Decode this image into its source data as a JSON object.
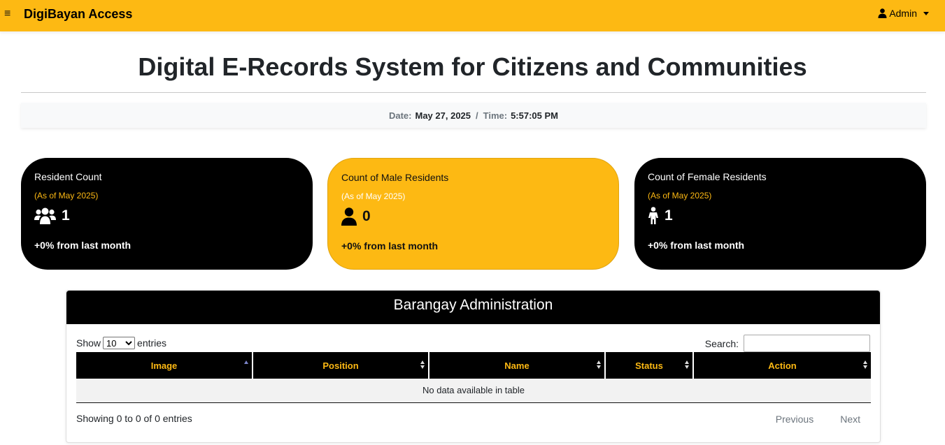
{
  "navbar": {
    "menu_icon": "hamburger-icon",
    "brand": "DigiBayan Access",
    "user_icon": "user-icon",
    "user_label": "Admin"
  },
  "header": {
    "title": "Digital E-Records System for Citizens and Communities"
  },
  "datetime": {
    "date_label": "Date:",
    "date_value": "May 27, 2025",
    "separator": "/",
    "time_label": "Time:",
    "time_value": "5:57:05 PM"
  },
  "cards": [
    {
      "title": "Resident Count",
      "subtitle": "(As of May 2025)",
      "icon": "users-icon",
      "value": "1",
      "footer": "+0% from last month",
      "theme": "dark"
    },
    {
      "title": "Count of Male Residents",
      "subtitle": "(As of May 2025)",
      "icon": "male-icon",
      "value": "0",
      "footer": "+0% from last month",
      "theme": "gold"
    },
    {
      "title": "Count of Female Residents",
      "subtitle": "(As of May 2025)",
      "icon": "female-icon",
      "value": "1",
      "footer": "+0% from last month",
      "theme": "dark"
    }
  ],
  "admin_table": {
    "heading": "Barangay Administration",
    "show_label": "Show",
    "entries_label": "entries",
    "page_length": "10",
    "page_length_options": [
      "10"
    ],
    "search_label": "Search:",
    "search_value": "",
    "columns": [
      "Image",
      "Position",
      "Name",
      "Status",
      "Action"
    ],
    "sorted_column": "Image",
    "empty_message": "No data available in table",
    "info": "Showing 0 to 0 of 0 entries",
    "prev_label": "Previous",
    "next_label": "Next"
  },
  "colors": {
    "brand_yellow": "#fdb913",
    "card_dark": "#000000",
    "table_header_text": "#fdb913"
  }
}
